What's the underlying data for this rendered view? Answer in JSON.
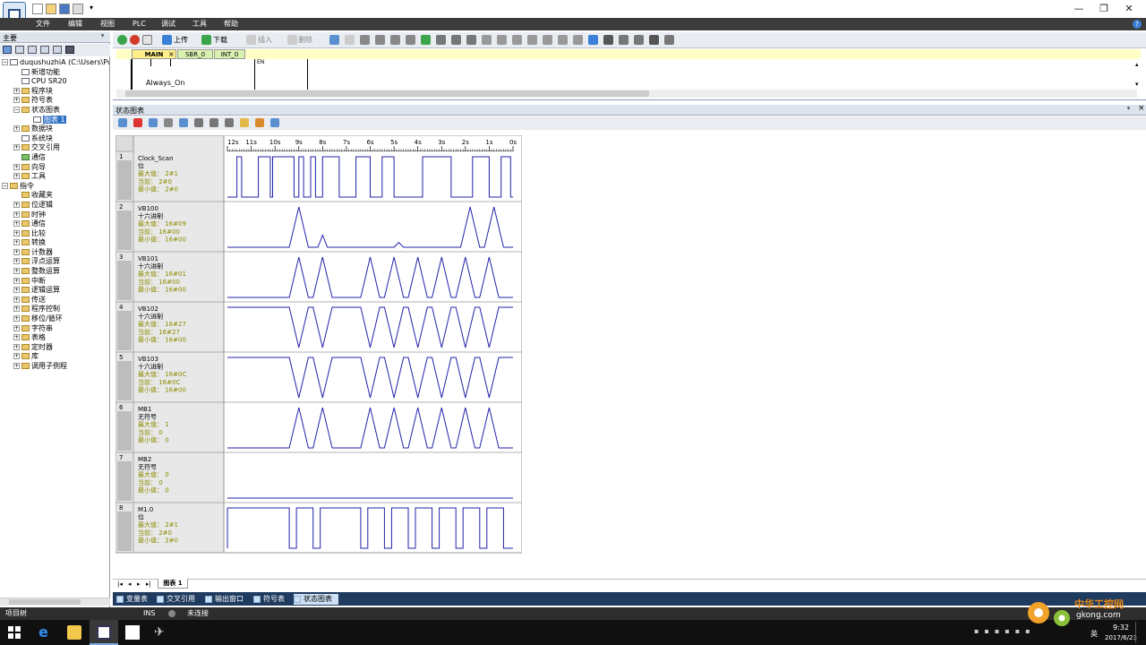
{
  "window": {
    "minimize": "—",
    "restore": "❐",
    "close": "✕"
  },
  "menu": {
    "items": [
      "文件",
      "编辑",
      "视图",
      "PLC",
      "调试",
      "工具",
      "帮助"
    ]
  },
  "left_pane": {
    "title": "主要",
    "pin": "ᵠ",
    "items": [
      {
        "label": "duqushuzhiA (C:\\Users\\Public",
        "indent": 0,
        "exp": "−",
        "ico": "doc"
      },
      {
        "label": "新增功能",
        "indent": 1,
        "exp": "",
        "ico": "doc"
      },
      {
        "label": "CPU SR20",
        "indent": 1,
        "exp": "",
        "ico": "doc"
      },
      {
        "label": "程序块",
        "indent": 1,
        "exp": "+",
        "ico": ""
      },
      {
        "label": "符号表",
        "indent": 1,
        "exp": "+",
        "ico": ""
      },
      {
        "label": "状态图表",
        "indent": 1,
        "exp": "−",
        "ico": ""
      },
      {
        "label": "图表 1",
        "indent": 2,
        "exp": "",
        "ico": "doc",
        "selected": true
      },
      {
        "label": "数据块",
        "indent": 1,
        "exp": "+",
        "ico": ""
      },
      {
        "label": "系统块",
        "indent": 1,
        "exp": "",
        "ico": "doc"
      },
      {
        "label": "交叉引用",
        "indent": 1,
        "exp": "+",
        "ico": ""
      },
      {
        "label": "通信",
        "indent": 1,
        "exp": "",
        "ico": "grn"
      },
      {
        "label": "向导",
        "indent": 1,
        "exp": "+",
        "ico": ""
      },
      {
        "label": "工具",
        "indent": 1,
        "exp": "+",
        "ico": ""
      },
      {
        "label": "指令",
        "indent": 0,
        "exp": "−",
        "ico": ""
      },
      {
        "label": "收藏夹",
        "indent": 1,
        "exp": "",
        "ico": ""
      },
      {
        "label": "位逻辑",
        "indent": 1,
        "exp": "+",
        "ico": ""
      },
      {
        "label": "时钟",
        "indent": 1,
        "exp": "+",
        "ico": ""
      },
      {
        "label": "通信",
        "indent": 1,
        "exp": "+",
        "ico": ""
      },
      {
        "label": "比较",
        "indent": 1,
        "exp": "+",
        "ico": ""
      },
      {
        "label": "转换",
        "indent": 1,
        "exp": "+",
        "ico": ""
      },
      {
        "label": "计数器",
        "indent": 1,
        "exp": "+",
        "ico": ""
      },
      {
        "label": "浮点运算",
        "indent": 1,
        "exp": "+",
        "ico": ""
      },
      {
        "label": "整数运算",
        "indent": 1,
        "exp": "+",
        "ico": ""
      },
      {
        "label": "中断",
        "indent": 1,
        "exp": "+",
        "ico": ""
      },
      {
        "label": "逻辑运算",
        "indent": 1,
        "exp": "+",
        "ico": ""
      },
      {
        "label": "传送",
        "indent": 1,
        "exp": "+",
        "ico": ""
      },
      {
        "label": "程序控制",
        "indent": 1,
        "exp": "+",
        "ico": ""
      },
      {
        "label": "移位/循环",
        "indent": 1,
        "exp": "+",
        "ico": ""
      },
      {
        "label": "字符串",
        "indent": 1,
        "exp": "+",
        "ico": ""
      },
      {
        "label": "表格",
        "indent": 1,
        "exp": "+",
        "ico": ""
      },
      {
        "label": "定时器",
        "indent": 1,
        "exp": "+",
        "ico": ""
      },
      {
        "label": "库",
        "indent": 1,
        "exp": "+",
        "ico": ""
      },
      {
        "label": "调用子例程",
        "indent": 1,
        "exp": "+",
        "ico": ""
      }
    ]
  },
  "toolbar": {
    "upload": "上传",
    "download": "下载",
    "insert": "插入",
    "delete": "删除"
  },
  "editor": {
    "tabs": [
      "MAIN",
      "SBR_0",
      "INT_0"
    ],
    "tab_close": "×",
    "contact_label": "Always_On",
    "en_label": "EN"
  },
  "status_chart": {
    "title": "状态图表",
    "pin": "ᵠ",
    "close": "×",
    "sheet_tab": "图表 1",
    "nav": [
      "|◂",
      "◂",
      "▸",
      "▸|"
    ]
  },
  "chart_data": {
    "type": "timing",
    "time_ticks": [
      "12s",
      "11s",
      "10s",
      "9s",
      "8s",
      "7s",
      "6s",
      "5s",
      "4s",
      "3s",
      "2s",
      "1s",
      "0s"
    ],
    "time_range_s": [
      12,
      0
    ],
    "rows": [
      {
        "index": "1",
        "name": "Clock_Scan",
        "format": "位",
        "max": "最大值：  2#1",
        "cur": "当前：    2#0",
        "min": "最小值：  2#0",
        "kind": "digital",
        "edges": [
          11.6,
          11.4,
          10.7,
          10.2,
          10.1,
          9.2,
          9.0,
          8.8,
          8.5,
          8.3,
          8.0,
          7.3,
          6.6,
          6.0,
          5.5,
          5.0,
          3.8,
          2.6,
          1.7,
          1.0,
          0.5,
          0.1
        ]
      },
      {
        "index": "2",
        "name": "VB100",
        "format": "十六进制",
        "max": "最大值：  16#09",
        "cur": "当前：   16#00",
        "min": "最小值：  16#00",
        "kind": "analog",
        "points": [
          [
            12,
            0
          ],
          [
            9.4,
            0
          ],
          [
            9,
            1
          ],
          [
            8.6,
            0
          ],
          [
            8.2,
            0
          ],
          [
            8,
            0.3
          ],
          [
            7.8,
            0
          ],
          [
            5,
            0
          ],
          [
            4.8,
            0.12
          ],
          [
            4.6,
            0
          ],
          [
            2.2,
            0
          ],
          [
            1.8,
            1
          ],
          [
            1.4,
            0
          ],
          [
            1.2,
            0
          ],
          [
            0.8,
            1
          ],
          [
            0.4,
            0
          ],
          [
            0,
            0
          ]
        ]
      },
      {
        "index": "3",
        "name": "VB101",
        "format": "十六进制",
        "max": "最大值：  16#01",
        "cur": "当前：   16#00",
        "min": "最小值：  16#00",
        "kind": "analog",
        "points": [
          [
            12,
            0
          ],
          [
            9.4,
            0
          ],
          [
            9,
            1
          ],
          [
            8.6,
            0
          ],
          [
            8.4,
            0
          ],
          [
            8,
            1
          ],
          [
            7.6,
            0
          ],
          [
            6.4,
            0
          ],
          [
            6,
            1
          ],
          [
            5.6,
            0
          ],
          [
            5.4,
            0
          ],
          [
            5,
            1
          ],
          [
            4.6,
            0
          ],
          [
            4.4,
            0
          ],
          [
            4,
            1
          ],
          [
            3.6,
            0
          ],
          [
            3.4,
            0
          ],
          [
            3,
            1
          ],
          [
            2.6,
            0
          ],
          [
            2.4,
            0
          ],
          [
            2,
            1
          ],
          [
            1.6,
            0
          ],
          [
            1.4,
            0
          ],
          [
            1,
            1
          ],
          [
            0.6,
            0
          ],
          [
            0,
            0
          ]
        ]
      },
      {
        "index": "4",
        "name": "VB102",
        "format": "十六进制",
        "max": "最大值：  16#27",
        "cur": "当前：   16#27",
        "min": "最小值：  16#00",
        "kind": "analog",
        "points": [
          [
            12,
            1
          ],
          [
            9.4,
            1
          ],
          [
            9,
            0
          ],
          [
            8.6,
            1
          ],
          [
            8.4,
            1
          ],
          [
            8,
            0
          ],
          [
            7.6,
            1
          ],
          [
            6.4,
            1
          ],
          [
            6,
            0
          ],
          [
            5.6,
            1
          ],
          [
            5.4,
            1
          ],
          [
            5,
            0
          ],
          [
            4.6,
            1
          ],
          [
            4.4,
            1
          ],
          [
            4,
            0
          ],
          [
            3.6,
            1
          ],
          [
            3.4,
            1
          ],
          [
            3,
            0
          ],
          [
            2.6,
            1
          ],
          [
            2.4,
            1
          ],
          [
            2,
            0
          ],
          [
            1.6,
            1
          ],
          [
            1.4,
            1
          ],
          [
            1,
            0
          ],
          [
            0.6,
            1
          ],
          [
            0,
            1
          ]
        ]
      },
      {
        "index": "5",
        "name": "VB103",
        "format": "十六进制",
        "max": "最大值：  16#0C",
        "cur": "当前：   16#0C",
        "min": "最小值：  16#00",
        "kind": "analog",
        "points": [
          [
            12,
            1
          ],
          [
            9.4,
            1
          ],
          [
            9,
            0
          ],
          [
            8.6,
            1
          ],
          [
            8.4,
            1
          ],
          [
            8,
            0
          ],
          [
            7.6,
            1
          ],
          [
            6.4,
            1
          ],
          [
            6,
            0
          ],
          [
            5.6,
            1
          ],
          [
            5.4,
            1
          ],
          [
            5,
            0
          ],
          [
            4.6,
            1
          ],
          [
            4.4,
            1
          ],
          [
            4,
            0
          ],
          [
            3.6,
            1
          ],
          [
            3.4,
            1
          ],
          [
            3,
            0
          ],
          [
            2.6,
            1
          ],
          [
            2.4,
            1
          ],
          [
            2,
            0
          ],
          [
            1.6,
            1
          ],
          [
            1.4,
            1
          ],
          [
            1,
            0
          ],
          [
            0.6,
            1
          ],
          [
            0,
            1
          ]
        ]
      },
      {
        "index": "6",
        "name": "MB1",
        "format": "无符号",
        "max": "最大值：  1",
        "cur": "当前：    0",
        "min": "最小值：  0",
        "kind": "analog",
        "points": [
          [
            12,
            0
          ],
          [
            9.4,
            0
          ],
          [
            9,
            1
          ],
          [
            8.6,
            0
          ],
          [
            8.4,
            0
          ],
          [
            8,
            1
          ],
          [
            7.6,
            0
          ],
          [
            6.4,
            0
          ],
          [
            6,
            1
          ],
          [
            5.6,
            0
          ],
          [
            5.4,
            0
          ],
          [
            5,
            1
          ],
          [
            4.6,
            0
          ],
          [
            4.4,
            0
          ],
          [
            4,
            1
          ],
          [
            3.6,
            0
          ],
          [
            3.4,
            0
          ],
          [
            3,
            1
          ],
          [
            2.6,
            0
          ],
          [
            2.4,
            0
          ],
          [
            2,
            1
          ],
          [
            1.6,
            0
          ],
          [
            1.4,
            0
          ],
          [
            1,
            1
          ],
          [
            0.6,
            0
          ],
          [
            0,
            0
          ]
        ]
      },
      {
        "index": "7",
        "name": "MB2",
        "format": "无符号",
        "max": "最大值：  0",
        "cur": "当前：    0",
        "min": "最小值：  0",
        "kind": "analog",
        "points": [
          [
            12,
            0
          ],
          [
            0,
            0
          ]
        ]
      },
      {
        "index": "8",
        "name": "M1.0",
        "format": "位",
        "max": "最大值：  2#1",
        "cur": "当前：    2#0",
        "min": "最小值：  2#0",
        "kind": "digital",
        "edges": [
          12,
          9.4,
          9.1,
          8.4,
          8.1,
          6.4,
          6.1,
          5.4,
          5.1,
          4.4,
          4.1,
          3.4,
          3.1,
          2.4,
          2.1,
          1.4,
          1.1,
          0.4
        ]
      }
    ]
  },
  "bottom_tabs": [
    "变量表",
    "交叉引用",
    "输出窗口",
    "符号表",
    "状态图表"
  ],
  "statusbar": {
    "left": "项目树",
    "ins": "INS",
    "conn": "未连接"
  },
  "taskbar": {
    "time": "9:32",
    "date": "2017/6/23",
    "lang": "英"
  },
  "watermark": {
    "line1": "中华工控网",
    "line2": "gkong.com"
  },
  "colors": {
    "trace": "#2222aa",
    "value_text": "#8b8b00"
  }
}
